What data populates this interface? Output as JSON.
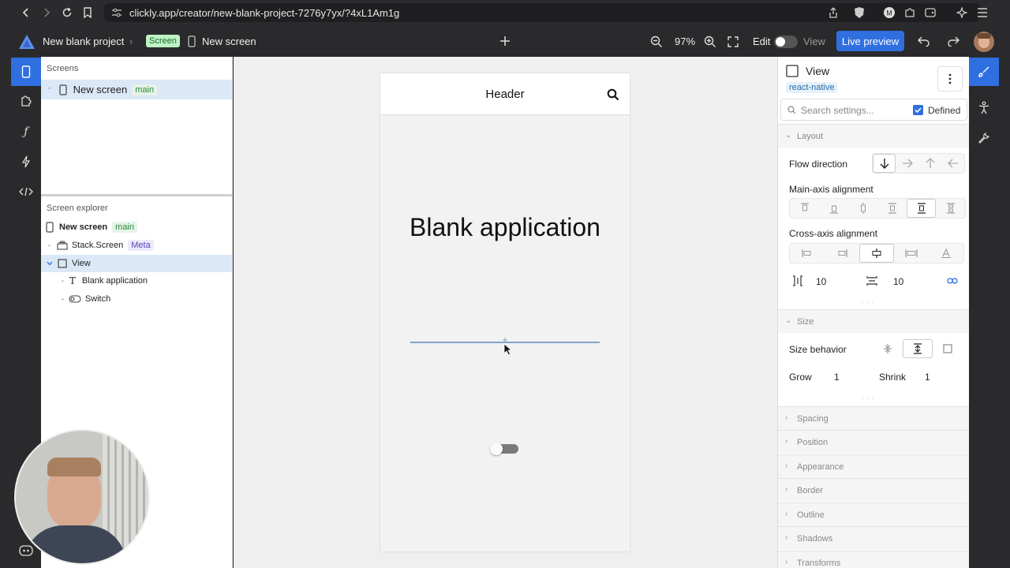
{
  "browser": {
    "url": "clickly.app/creator/new-blank-project-7276y7yx/?4xL1Am1g"
  },
  "appbar": {
    "project_name": "New blank project",
    "screen_badge": "Screen",
    "screen_name": "New screen",
    "zoom": "97%",
    "edit_label": "Edit",
    "view_label": "View",
    "live_preview": "Live preview"
  },
  "left_panel": {
    "screens_title": "Screens",
    "screens": [
      {
        "label": "New screen",
        "tag": "main"
      }
    ],
    "explorer_title": "Screen explorer",
    "tree": [
      {
        "label": "New screen",
        "tag": "main"
      },
      {
        "label": "Stack.Screen",
        "tag": "Meta"
      },
      {
        "label": "View"
      },
      {
        "label": "Blank application"
      },
      {
        "label": "Switch"
      }
    ]
  },
  "canvas": {
    "header_title": "Header",
    "blank_text": "Blank application"
  },
  "right_panel": {
    "component_name": "View",
    "component_tag": "react-native",
    "search_placeholder": "Search settings...",
    "defined_label": "Defined",
    "layout_title": "Layout",
    "flow_direction": "Flow direction",
    "main_axis": "Main-axis alignment",
    "cross_axis": "Cross-axis alignment",
    "gap_x": "10",
    "gap_y": "10",
    "size_title": "Size",
    "size_behavior": "Size behavior",
    "grow_label": "Grow",
    "grow_value": "1",
    "shrink_label": "Shrink",
    "shrink_value": "1",
    "sections": [
      "Spacing",
      "Position",
      "Appearance",
      "Border",
      "Outline",
      "Shadows",
      "Transforms"
    ]
  },
  "colors": {
    "accent": "#2f6fe0",
    "selected_row": "#dbe8f7",
    "main_tag": "#2b8a3e",
    "meta_tag": "#5a46b8"
  }
}
